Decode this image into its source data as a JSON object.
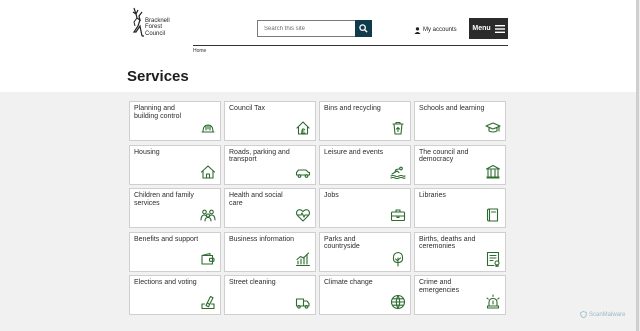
{
  "header": {
    "logo_text": "Bracknell\nForest\nCouncil",
    "search_placeholder": "Search this site",
    "account_label": "My accounts",
    "menu_label": "Menu"
  },
  "breadcrumb": "Home",
  "page_title": "Services",
  "services": [
    {
      "label": "Planning and building control",
      "icon": "hard-hat-icon"
    },
    {
      "label": "Council Tax",
      "icon": "house-pound-icon"
    },
    {
      "label": "Bins and recycling",
      "icon": "recycle-bin-icon"
    },
    {
      "label": "Schools and learning",
      "icon": "graduation-cap-icon"
    },
    {
      "label": "Housing",
      "icon": "house-icon"
    },
    {
      "label": "Roads, parking and transport",
      "icon": "car-icon"
    },
    {
      "label": "Leisure and events",
      "icon": "swimmer-icon"
    },
    {
      "label": "The council and democracy",
      "icon": "columns-building-icon"
    },
    {
      "label": "Children and family services",
      "icon": "family-icon"
    },
    {
      "label": "Health and social care",
      "icon": "heartbeat-icon"
    },
    {
      "label": "Jobs",
      "icon": "briefcase-icon"
    },
    {
      "label": "Libraries",
      "icon": "book-icon"
    },
    {
      "label": "Benefits and support",
      "icon": "wallet-icon"
    },
    {
      "label": "Business information",
      "icon": "bar-chart-icon"
    },
    {
      "label": "Parks and countryside",
      "icon": "tree-icon"
    },
    {
      "label": "Births, deaths and ceremonies",
      "icon": "certificate-icon"
    },
    {
      "label": "Elections and voting",
      "icon": "ballot-icon"
    },
    {
      "label": "Street cleaning",
      "icon": "street-sweeper-icon"
    },
    {
      "label": "Climate change",
      "icon": "globe-icon"
    },
    {
      "label": "Crime and emergencies",
      "icon": "siren-icon"
    }
  ],
  "watermark": "ScanMalware",
  "colors": {
    "icon_green": "#2e6b2f",
    "search_button": "#0f3b4c",
    "menu_button": "#2b2b2b",
    "page_background": "#f1f1f1"
  }
}
